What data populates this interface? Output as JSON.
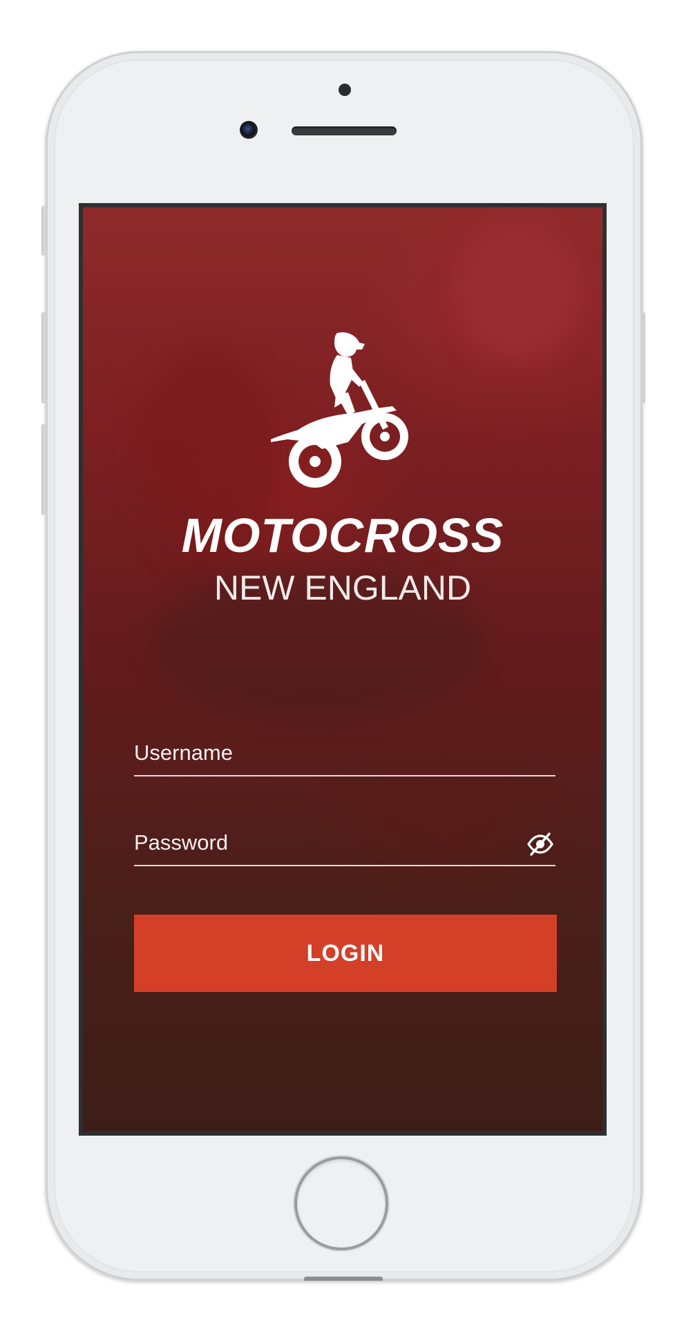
{
  "app": {
    "brand_title": "MOTOCROSS",
    "brand_subtitle": "NEW ENGLAND",
    "logo_icon": "dirt-bike-rider-icon"
  },
  "login_form": {
    "username": {
      "value": "",
      "placeholder": "Username"
    },
    "password": {
      "value": "",
      "placeholder": "Password",
      "visibility_icon": "eye-off-icon"
    },
    "submit_label": "LOGIN"
  },
  "colors": {
    "accent": "#d43f27",
    "background_top": "#8f2a2a",
    "background_bottom": "#3e1d18",
    "text": "#ffffff"
  }
}
